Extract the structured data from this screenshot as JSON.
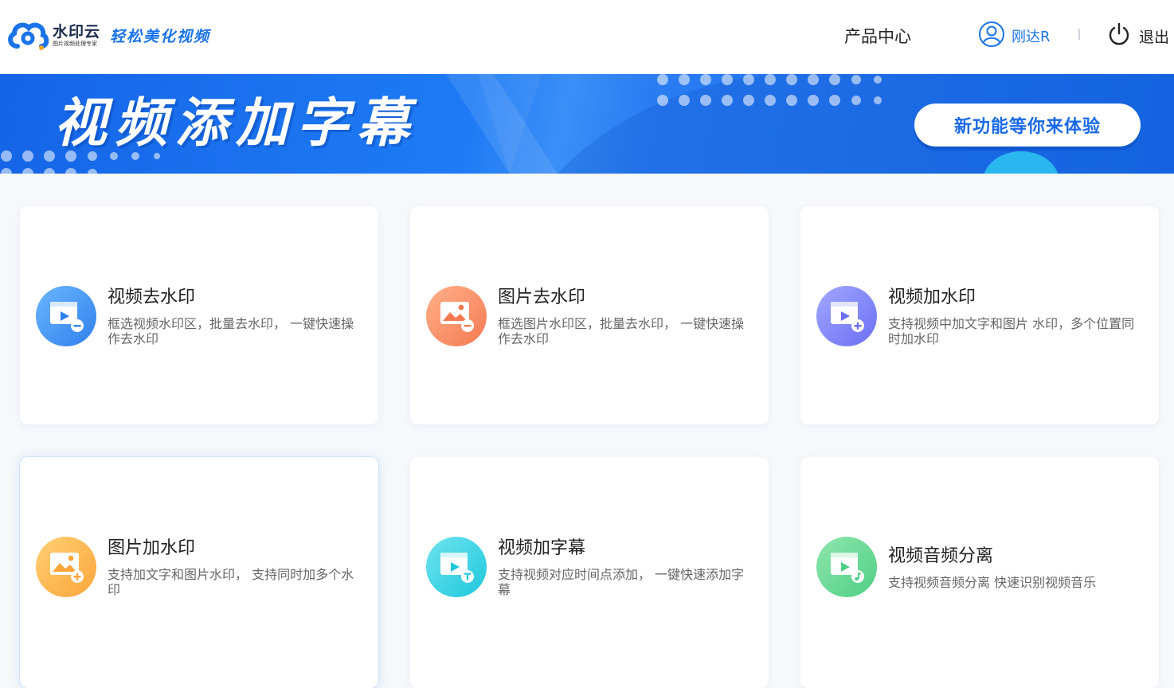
{
  "header": {
    "logo_name": "水印云",
    "logo_sub": "图片视频处理专家",
    "slogan": "轻松美化视频",
    "nav_product": "产品中心",
    "user_name": "刚达R",
    "logout_label": "退出"
  },
  "banner": {
    "title": "视频添加字幕",
    "cta": "新功能等你来体验"
  },
  "cards": [
    {
      "title": "视频去水印",
      "desc": "框选视频水印区，批量去水印， 一键快速操作去水印",
      "icon": "video-remove-icon",
      "color_from": "#6bb6ff",
      "color_to": "#2f80ed"
    },
    {
      "title": "图片去水印",
      "desc": "框选图片水印区，批量去水印， 一键快速操作去水印",
      "icon": "image-remove-icon",
      "color_from": "#ffb08a",
      "color_to": "#f57a52"
    },
    {
      "title": "视频加水印",
      "desc": "支持视频中加文字和图片 水印，多个位置同时加水印",
      "icon": "video-add-icon",
      "color_from": "#a2a8ff",
      "color_to": "#6a6ef5"
    },
    {
      "title": "图片加水印",
      "desc": "支持加文字和图片水印， 支持同时加多个水印",
      "icon": "image-add-icon",
      "color_from": "#ffd074",
      "color_to": "#fba53a"
    },
    {
      "title": "视频加字幕",
      "desc": "支持视频对应时间点添加， 一键快速添加字幕",
      "icon": "video-subtitle-icon",
      "color_from": "#6fe3ee",
      "color_to": "#1ec8dc"
    },
    {
      "title": "视频音频分离",
      "desc": "支持视频音频分离 快速识别视频音乐",
      "icon": "video-audio-icon",
      "color_from": "#8fe6ac",
      "color_to": "#4fcf86"
    }
  ],
  "colors": {
    "accent": "#1a73e8",
    "banner": "#1e7bf5"
  }
}
